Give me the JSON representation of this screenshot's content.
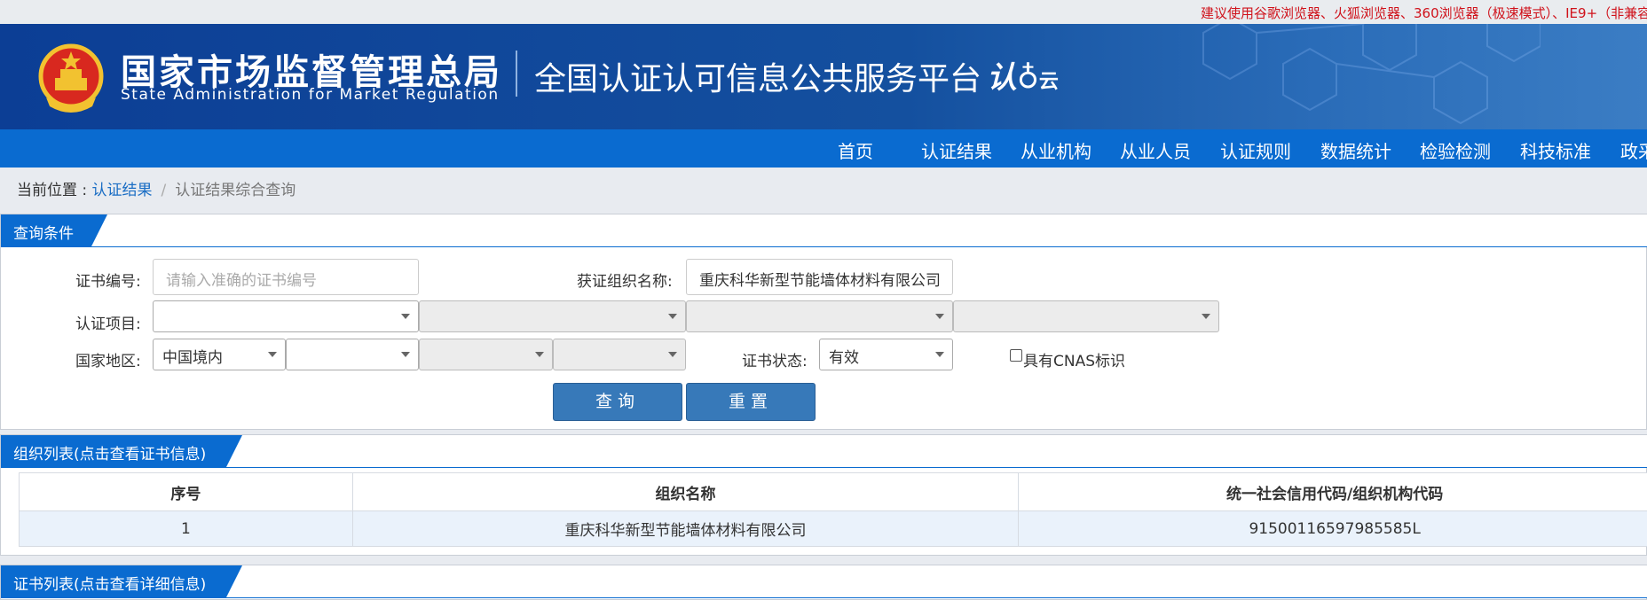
{
  "top_notice": "建议使用谷歌浏览器、火狐浏览器、360浏览器（极速模式）、IE9+（非兼容",
  "header": {
    "org_name_cn": "国家市场监督管理总局",
    "org_name_en": "State Administration  for  Market Regulation",
    "platform_title": "全国认证认可信息公共服务平台",
    "logo_main": "认",
    "logo_sub": "云"
  },
  "nav": [
    "首页",
    "认证结果",
    "从业机构",
    "从业人员",
    "认证规则",
    "数据统计",
    "检验检测",
    "科技标准",
    "政采"
  ],
  "breadcrumb": {
    "prefix": "当前位置 :",
    "link": "认证结果",
    "separator": "/",
    "current": "认证结果综合查询"
  },
  "query_panel": {
    "title": "查询条件",
    "cert_no_label": "证书编号:",
    "cert_no_placeholder": "请输入准确的证书编号",
    "org_name_label": "获证组织名称:",
    "org_name_value": "重庆科华新型节能墙体材料有限公司",
    "project_label": "认证项目:",
    "project_selects": [
      "",
      "",
      "",
      ""
    ],
    "region_label": "国家地区:",
    "region_selects": [
      "中国境内",
      "",
      "",
      ""
    ],
    "status_label": "证书状态:",
    "status_value": "有效",
    "cnas_label": "具有CNAS标识",
    "query_button": "查询",
    "reset_button": "重置"
  },
  "org_panel": {
    "title": "组织列表(点击查看证书信息)",
    "columns": [
      "序号",
      "组织名称",
      "统一社会信用代码/组织机构代码"
    ],
    "rows": [
      [
        "1",
        "重庆科华新型节能墙体材料有限公司",
        "91500116597985585L"
      ]
    ]
  },
  "cert_panel": {
    "title": "证书列表(点击查看详细信息)"
  },
  "colors": {
    "header_blue": "#0c3e95",
    "nav_blue": "#0a6bd0",
    "button_blue": "#3779b9",
    "notice_red": "#d0121b"
  }
}
